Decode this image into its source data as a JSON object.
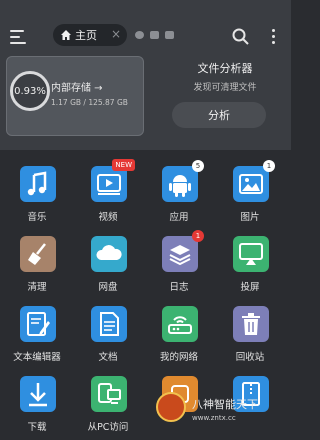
{
  "header": {
    "tab_label": "主页",
    "tab_close": "×"
  },
  "storage": {
    "title": "内部存储 →",
    "percent": "0.93%",
    "used_total": "1.17 GB / 125.87 GB"
  },
  "analyzer": {
    "title": "文件分析器",
    "subtitle": "发现可清理文件",
    "button": "分析"
  },
  "grid": [
    {
      "label": "音乐",
      "icon": "music-icon",
      "color": "#2f8fe0",
      "badge": ""
    },
    {
      "label": "视频",
      "icon": "video-icon",
      "color": "#2f8fe0",
      "badge": "NEW"
    },
    {
      "label": "应用",
      "icon": "android-icon",
      "color": "#2f8fe0",
      "badge": "5"
    },
    {
      "label": "图片",
      "icon": "image-icon",
      "color": "#2f8fe0",
      "badge": "1"
    },
    {
      "label": "清理",
      "icon": "broom-icon",
      "color": "#a7836a",
      "badge": ""
    },
    {
      "label": "网盘",
      "icon": "cloud-icon",
      "color": "#35a9cc",
      "badge": ""
    },
    {
      "label": "日志",
      "icon": "layers-icon",
      "color": "#7d7fb8",
      "badge": "1"
    },
    {
      "label": "投屏",
      "icon": "cast-icon",
      "color": "#3cb371",
      "badge": ""
    },
    {
      "label": "文本编辑器",
      "icon": "edit-icon",
      "color": "#2f8fe0",
      "badge": ""
    },
    {
      "label": "文档",
      "icon": "document-icon",
      "color": "#2f8fe0",
      "badge": ""
    },
    {
      "label": "我的网络",
      "icon": "router-icon",
      "color": "#3cb371",
      "badge": ""
    },
    {
      "label": "回收站",
      "icon": "trash-icon",
      "color": "#7d7fb8",
      "badge": ""
    },
    {
      "label": "下载",
      "icon": "download-icon",
      "color": "#2f8fe0",
      "badge": ""
    },
    {
      "label": "从PC访问",
      "icon": "pc-access-icon",
      "color": "#3cb371",
      "badge": ""
    },
    {
      "label": "",
      "icon": "app-icon",
      "color": "#e08a2f",
      "badge": ""
    },
    {
      "label": "",
      "icon": "zip-icon",
      "color": "#2f8fe0",
      "badge": ""
    }
  ],
  "watermark": {
    "text": "八神智能天下",
    "sub": "www.zntx.cc"
  }
}
